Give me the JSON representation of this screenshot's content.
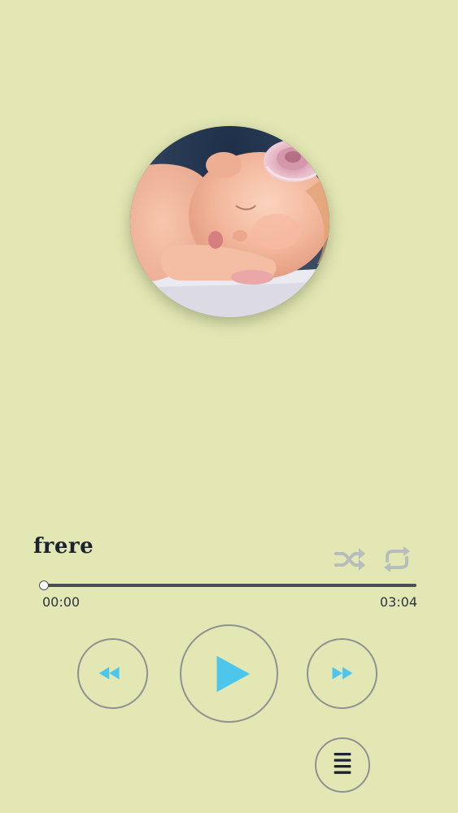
{
  "track": {
    "title": "frere"
  },
  "progress": {
    "current_time": "00:00",
    "total_time": "03:04",
    "fraction": 0.0
  },
  "controls": {
    "shuffle_icon": "shuffle-icon",
    "repeat_icon": "repeat-icon",
    "rewind_icon": "rewind-icon",
    "play_icon": "play-icon",
    "forward_icon": "fast-forward-icon",
    "playlist_icon": "playlist-menu-icon"
  },
  "colors": {
    "background": "#e3e7b4",
    "accent": "#4ec6ec",
    "button_border": "#8d9292",
    "inactive_icon": "#b7bcbc",
    "text": "#1b2330"
  }
}
